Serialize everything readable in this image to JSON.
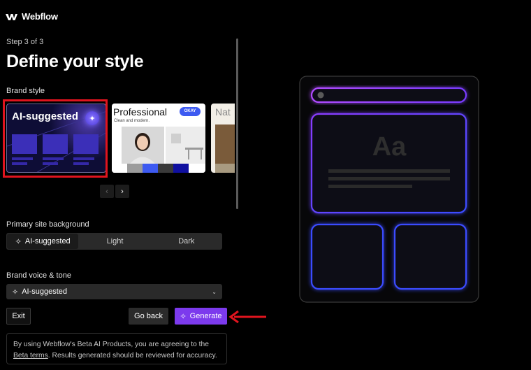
{
  "app": {
    "name": "Webflow"
  },
  "wizard": {
    "step_text": "Step 3 of 3",
    "title": "Define your style"
  },
  "brand_style": {
    "label": "Brand style",
    "cards": [
      {
        "title": "AI-suggested",
        "selected": true
      },
      {
        "title": "Professional",
        "subtitle": "Clean and modern.",
        "button": "OKAY"
      },
      {
        "title": "Nat"
      }
    ]
  },
  "background": {
    "label": "Primary site background",
    "options": [
      "AI-suggested",
      "Light",
      "Dark"
    ],
    "selected": "AI-suggested"
  },
  "voice": {
    "label": "Brand voice & tone",
    "value": "AI-suggested"
  },
  "buttons": {
    "exit": "Exit",
    "go_back": "Go back",
    "generate": "Generate"
  },
  "notice": {
    "text_before": "By using Webflow's Beta AI Products, you are agreeing to the",
    "link": "Beta terms",
    "text_after": ". Results generated should be reviewed for accuracy."
  },
  "preview": {
    "sample_text": "Aa"
  },
  "colors": {
    "accent": "#7c3aed",
    "highlight": "#e0141e",
    "neon_purple": "#b14cff",
    "neon_blue": "#3a4cff"
  }
}
